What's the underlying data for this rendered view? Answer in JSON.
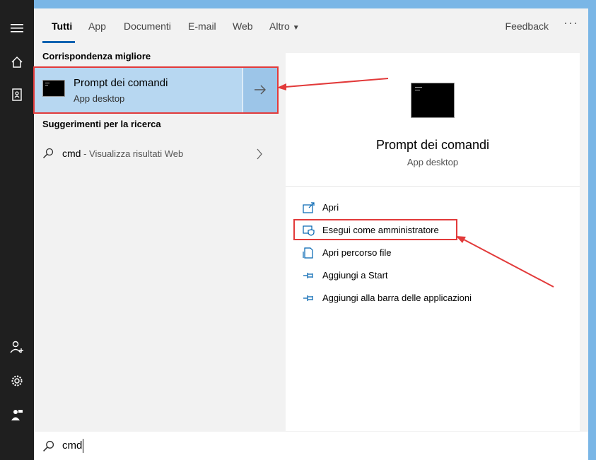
{
  "tabs": [
    {
      "label": "Tutti"
    },
    {
      "label": "App"
    },
    {
      "label": "Documenti"
    },
    {
      "label": "E-mail"
    },
    {
      "label": "Web"
    },
    {
      "label": "Altro"
    }
  ],
  "header": {
    "feedback": "Feedback",
    "more": "···"
  },
  "left": {
    "best_match_title": "Corrispondenza migliore",
    "best_match": {
      "name": "Prompt dei comandi",
      "type": "App desktop"
    },
    "suggestions_title": "Suggerimenti per la ricerca",
    "suggestion": {
      "query": "cmd",
      "hint": " - Visualizza risultati Web"
    }
  },
  "right": {
    "title": "Prompt dei comandi",
    "subtitle": "App desktop",
    "actions": [
      {
        "label": "Apri",
        "icon": "open-icon"
      },
      {
        "label": "Esegui come amministratore",
        "icon": "shield-admin-icon"
      },
      {
        "label": "Apri percorso file",
        "icon": "file-location-icon"
      },
      {
        "label": "Aggiungi a Start",
        "icon": "pin-icon"
      },
      {
        "label": "Aggiungi alla barra delle applicazioni",
        "icon": "pin-icon"
      }
    ]
  },
  "search": {
    "value": "cmd"
  },
  "colors": {
    "accent": "#0063b1",
    "highlight": "#b7d7f1",
    "annotation": "#e23a3a"
  }
}
